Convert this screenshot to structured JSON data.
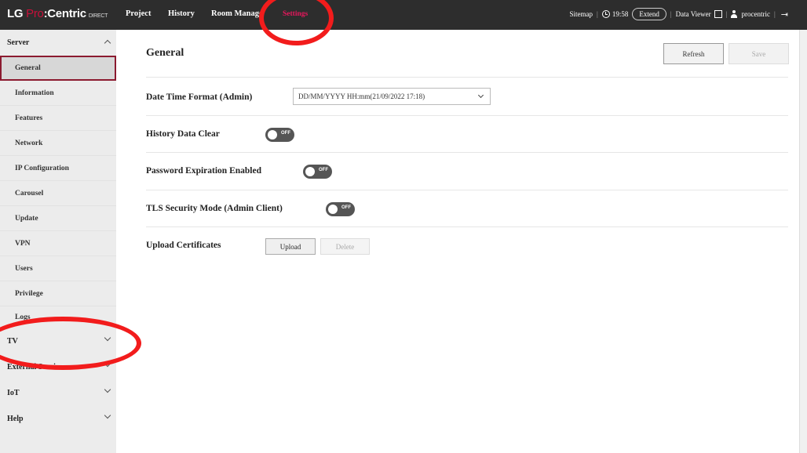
{
  "header": {
    "logo": {
      "lg": "LG",
      "pro": "Pro",
      "centric": ":Centric",
      "direct": "DIRECT"
    },
    "nav": [
      {
        "label": "Project"
      },
      {
        "label": "History"
      },
      {
        "label": "Room Management"
      },
      {
        "label": "Settings"
      }
    ],
    "sitemap": "Sitemap",
    "time": "19:58",
    "extend": "Extend",
    "data_viewer": "Data Viewer",
    "user": "procentric"
  },
  "sidebar": {
    "server": "Server",
    "items": [
      "General",
      "Information",
      "Features",
      "Network",
      "IP Configuration",
      "Carousel",
      "Update",
      "VPN",
      "Users",
      "Privilege",
      "Logs"
    ],
    "sections": [
      "TV",
      "External Service",
      "IoT",
      "Help"
    ]
  },
  "main": {
    "title": "General",
    "refresh": "Refresh",
    "save": "Save",
    "rows": {
      "datetime_label": "Date Time Format (Admin)",
      "datetime_value": "DD/MM/YYYY HH:mm(21/09/2022 17:18)",
      "history_label": "History Data Clear",
      "history_toggle": "OFF",
      "password_label": "Password Expiration Enabled",
      "password_toggle": "OFF",
      "tls_label": "TLS Security Mode (Admin Client)",
      "tls_toggle": "OFF",
      "upload_label": "Upload Certificates",
      "upload_btn": "Upload",
      "delete_btn": "Delete"
    }
  },
  "colors": {
    "topbar": "#2d2d2d",
    "accent": "#e8175d",
    "annotation": "#f21c1c"
  }
}
